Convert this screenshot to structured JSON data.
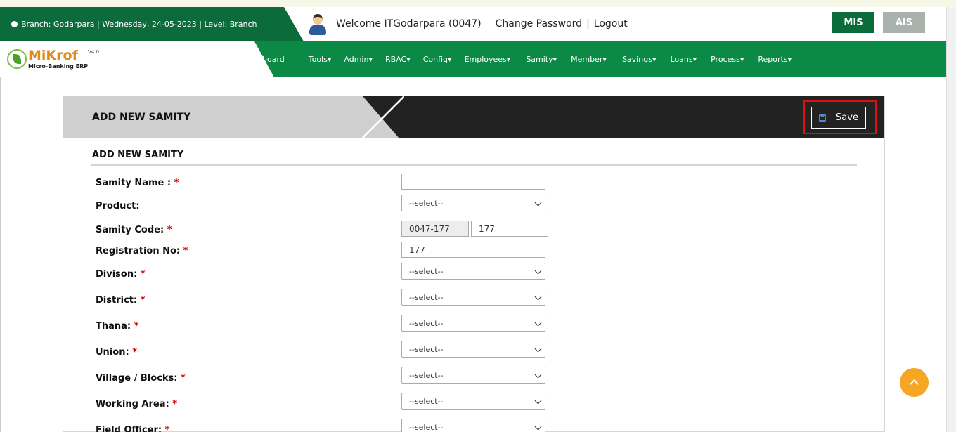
{
  "header": {
    "branch_info": "Branch: Godarpara | Wednesday, 24-05-2023 | Level: Branch",
    "welcome": "Welcome ITGodarpara (0047)",
    "change_password": "Change Password",
    "separator": "|",
    "logout": "Logout",
    "mis": "MIS",
    "ais": "AIS"
  },
  "logo": {
    "title": "MiKrof",
    "subtitle": "Micro-Banking ERP",
    "version": "V4.0"
  },
  "nav": {
    "items": [
      "board",
      "Tools",
      "Admin",
      "RBAC",
      "Config",
      "Employees",
      "Samity",
      "Member",
      "Savings",
      "Loans",
      "Process",
      "Reports"
    ],
    "dropdown_marker": "▾"
  },
  "panel": {
    "title": "ADD NEW SAMITY",
    "save": "Save",
    "section_title": "ADD NEW SAMITY"
  },
  "form": {
    "required_mark": "*",
    "samity_name": {
      "label": "Samity Name :",
      "value": ""
    },
    "product": {
      "label": "Product:",
      "value": "--select--"
    },
    "samity_code": {
      "label": "Samity Code:",
      "prefix": "0047-177",
      "value": "177"
    },
    "registration_no": {
      "label": "Registration No:",
      "value": "177"
    },
    "division": {
      "label": "Divison:",
      "value": "--select--"
    },
    "district": {
      "label": "District:",
      "value": "--select--"
    },
    "thana": {
      "label": "Thana:",
      "value": "--select--"
    },
    "union": {
      "label": "Union:",
      "value": "--select--"
    },
    "village": {
      "label": "Village / Blocks:",
      "value": "--select--"
    },
    "working_area": {
      "label": "Working Area:",
      "value": "--select--"
    },
    "field_officer": {
      "label": "Field Officer:",
      "value": "--select--"
    }
  },
  "colors": {
    "brand_green": "#0b8a45",
    "dark_green": "#0b6b3a",
    "highlight_red": "#e10e0e",
    "back_to_top": "#f5a623"
  },
  "icons": [
    "globe-icon",
    "user-avatar-icon",
    "floppy-disk-icon",
    "chevron-down-icon",
    "chevron-up-icon"
  ]
}
